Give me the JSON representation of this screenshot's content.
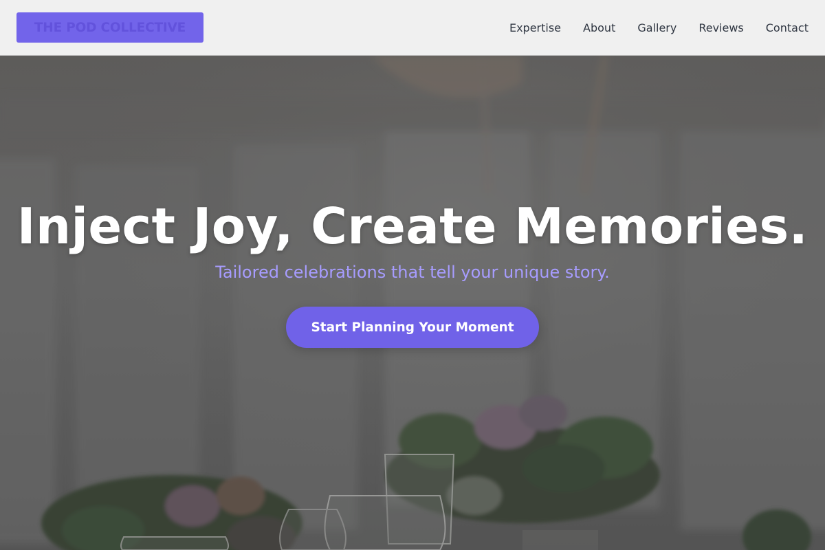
{
  "header": {
    "logo_text": "THE POD COLLECTIVE",
    "nav": [
      {
        "label": "Expertise"
      },
      {
        "label": "About"
      },
      {
        "label": "Gallery"
      },
      {
        "label": "Reviews"
      },
      {
        "label": "Contact"
      }
    ]
  },
  "hero": {
    "title": "Inject Joy, Create Memories.",
    "subtitle": "Tailored celebrations that tell your unique story.",
    "cta_label": "Start Planning Your Moment"
  },
  "colors": {
    "accent": "#7062e8",
    "subtitle": "#a79cff",
    "nav_text": "#2f3642",
    "header_bg": "#f0f0f0"
  }
}
